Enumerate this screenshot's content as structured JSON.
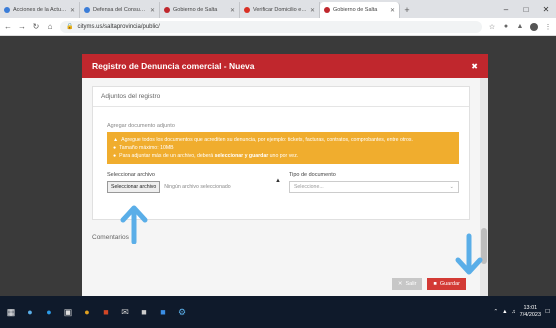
{
  "browser": {
    "tabs": [
      {
        "label": "Acciones de la Actuación",
        "color": "#3b7dd8",
        "active": false
      },
      {
        "label": "Defensa del Consumidor Digit",
        "color": "#3b7dd8",
        "active": false
      },
      {
        "label": "Gobierno de Salta",
        "color": "#c0272d",
        "active": false
      },
      {
        "label": "Verificar Domicilio electrónico",
        "color": "#d93025",
        "active": false
      },
      {
        "label": "Gobierno de Salta",
        "color": "#c0272d",
        "active": true
      }
    ],
    "url": "cityms.us/saltaprovincia/public/"
  },
  "modal": {
    "title": "Registro de Denuncia comercial - Nueva",
    "section_title": "Adjuntos del registro",
    "sub_label": "Agregar documento adjunto",
    "warning": {
      "line1": "Agregue todos los documentos que acrediten su denuncia, por ejemplo: tickets, facturas, contratos, comprobantes, entre otros.",
      "line2": "Tamaño máximo: 10MB",
      "line3_pre": "Para adjuntar más de un archivo, deberá ",
      "line3_bold": "seleccionar y guardar",
      "line3_post": " uno por vez."
    },
    "file_label": "Seleccionar archivo",
    "file_button": "Seleccionar archivo",
    "file_status": "Ningún archivo seleccionado",
    "doc_type_label": "Tipo de documento",
    "doc_type_placeholder": "Seleccione...",
    "comments_label": "Comentarios",
    "exit_label": "Salir",
    "save_label": "Guardar"
  },
  "taskbar": {
    "time": "13:01",
    "date": "7/4/2023"
  },
  "colors": {
    "brand_red": "#c0272d",
    "warning_orange": "#f0ad2e",
    "annotation_blue": "#5aaee8"
  }
}
